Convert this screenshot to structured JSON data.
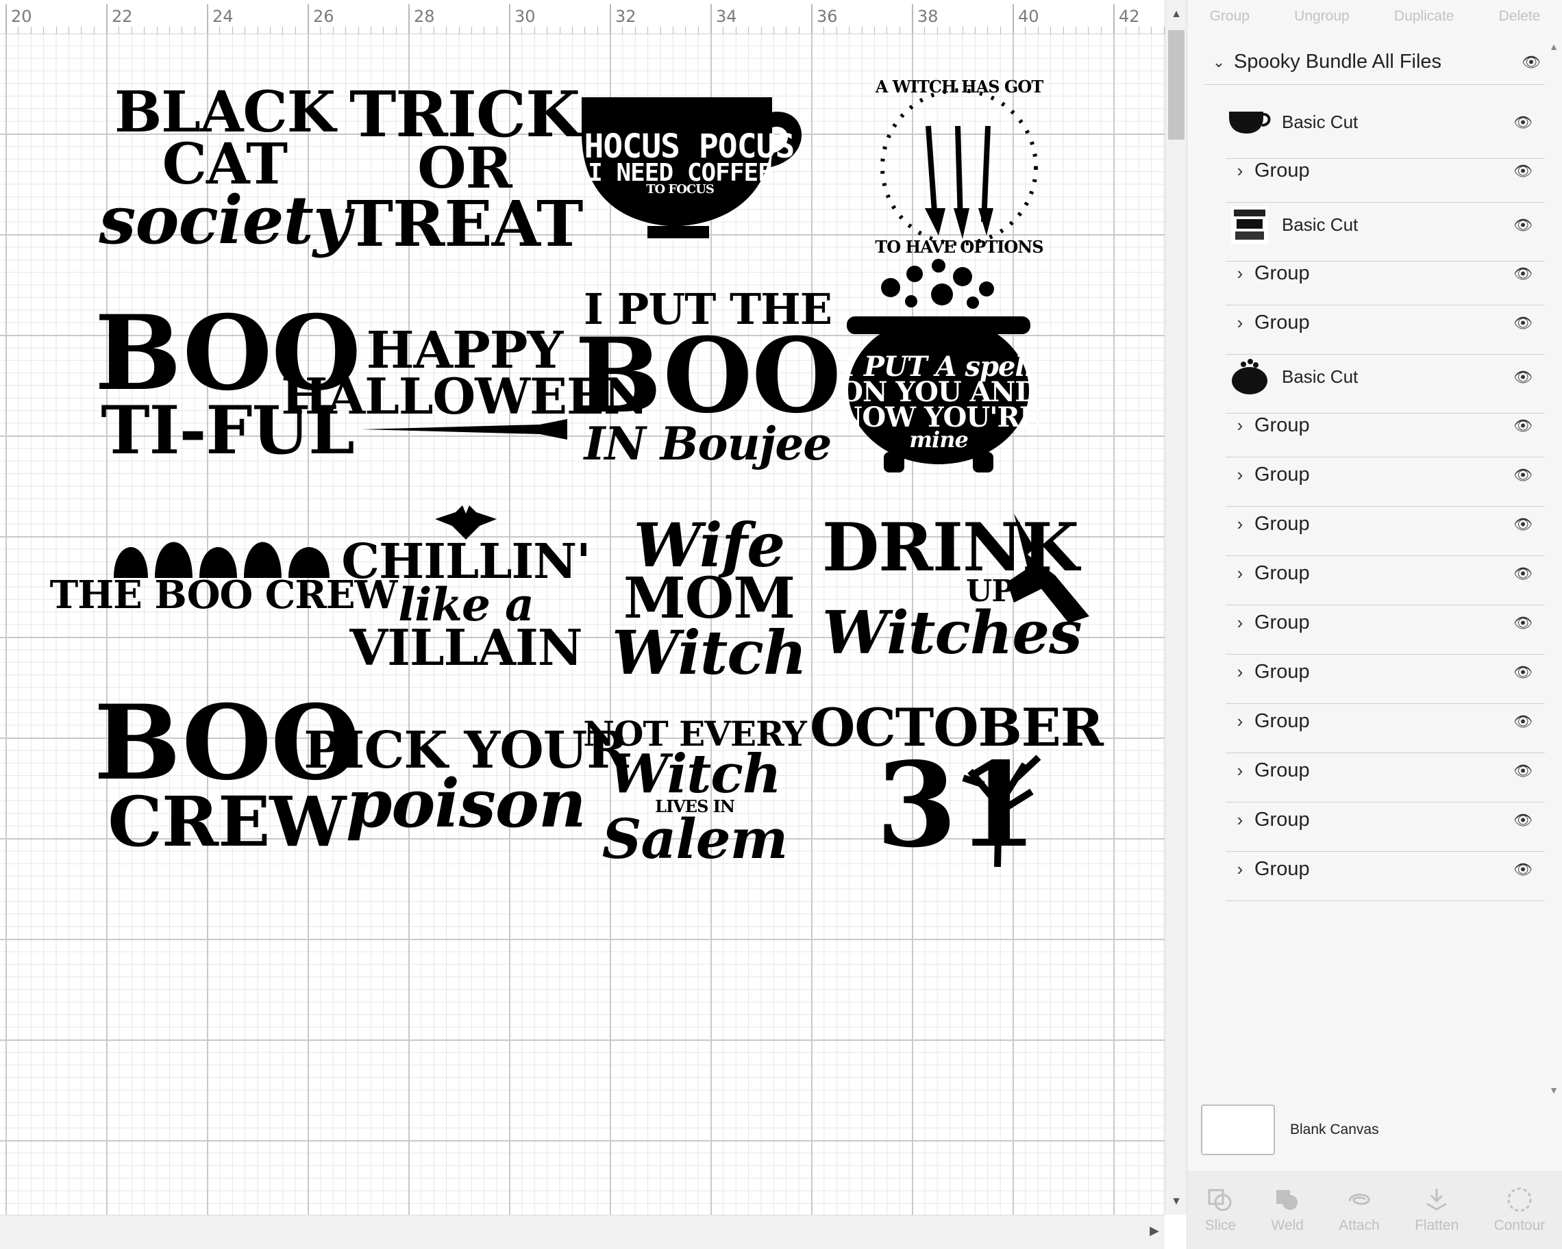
{
  "ruler": {
    "labels": [
      "20",
      "22",
      "24",
      "26",
      "28",
      "30",
      "32",
      "34",
      "36",
      "38",
      "40",
      "42"
    ]
  },
  "designs": [
    {
      "id": "black-cat-society",
      "lines": [
        "BLACK",
        "CAT",
        "society"
      ]
    },
    {
      "id": "trick-or-treat",
      "lines": [
        "TRICK",
        "OR",
        "TREAT"
      ]
    },
    {
      "id": "hocus-pocus",
      "lines": [
        "HOCUS POCUS",
        "I NEED COFFEE",
        "TO FOCUS"
      ]
    },
    {
      "id": "witch-options",
      "lines": [
        "A WITCH HAS GOT",
        "TO HAVE OPTIONS"
      ]
    },
    {
      "id": "bootiful",
      "lines": [
        "BOO",
        "TI-FUL"
      ]
    },
    {
      "id": "happy-halloween",
      "lines": [
        "HAPPY",
        "HALLOWEEN"
      ]
    },
    {
      "id": "boo-in-boujee",
      "lines": [
        "I PUT THE",
        "BOO",
        "IN Boujee"
      ]
    },
    {
      "id": "spell",
      "lines": [
        "I PUT A spell",
        "ON YOU AND",
        "NOW YOU'RE",
        "mine"
      ]
    },
    {
      "id": "boo-crew-ghosts",
      "lines": [
        "THE BOO CREW"
      ]
    },
    {
      "id": "chillin",
      "lines": [
        "CHILLIN'",
        "like a",
        "VILLAIN"
      ]
    },
    {
      "id": "wife-mom-witch",
      "lines": [
        "Wife",
        "MOM",
        "Witch"
      ]
    },
    {
      "id": "drink-up-witches",
      "lines": [
        "DRINK",
        "UP",
        "Witches"
      ]
    },
    {
      "id": "boo-crew",
      "lines": [
        "BOO",
        "CREW"
      ]
    },
    {
      "id": "pick-your-poison",
      "lines": [
        "PICK YOUR",
        "poison"
      ]
    },
    {
      "id": "not-every-witch",
      "lines": [
        "NOT EVERY",
        "Witch",
        "LIVES IN",
        "Salem"
      ]
    },
    {
      "id": "october-31",
      "lines": [
        "OCTOBER",
        "31"
      ]
    }
  ],
  "toolbar_top": [
    "Group",
    "Ungroup",
    "Duplicate",
    "Delete"
  ],
  "layers": {
    "header": "Spooky Bundle All Files",
    "rows": [
      {
        "type": "cut",
        "label": "Basic Cut",
        "thumb": "cup"
      },
      {
        "type": "group",
        "label": "Group"
      },
      {
        "type": "cut",
        "label": "Basic Cut",
        "thumb": "text"
      },
      {
        "type": "group",
        "label": "Group"
      },
      {
        "type": "group",
        "label": "Group"
      },
      {
        "type": "cut",
        "label": "Basic Cut",
        "thumb": "cauldron"
      },
      {
        "type": "group",
        "label": "Group"
      },
      {
        "type": "group",
        "label": "Group"
      },
      {
        "type": "group",
        "label": "Group"
      },
      {
        "type": "group",
        "label": "Group"
      },
      {
        "type": "group",
        "label": "Group"
      },
      {
        "type": "group",
        "label": "Group"
      },
      {
        "type": "group",
        "label": "Group"
      },
      {
        "type": "group",
        "label": "Group"
      },
      {
        "type": "group",
        "label": "Group"
      },
      {
        "type": "group",
        "label": "Group"
      }
    ]
  },
  "blank_canvas": "Blank Canvas",
  "toolbar_bottom": [
    "Slice",
    "Weld",
    "Attach",
    "Flatten",
    "Contour"
  ],
  "colors": {
    "panel_bg": "#f6f6f6",
    "disabled_text": "#c0c0c0",
    "grid_major": "#c9c9c9"
  }
}
